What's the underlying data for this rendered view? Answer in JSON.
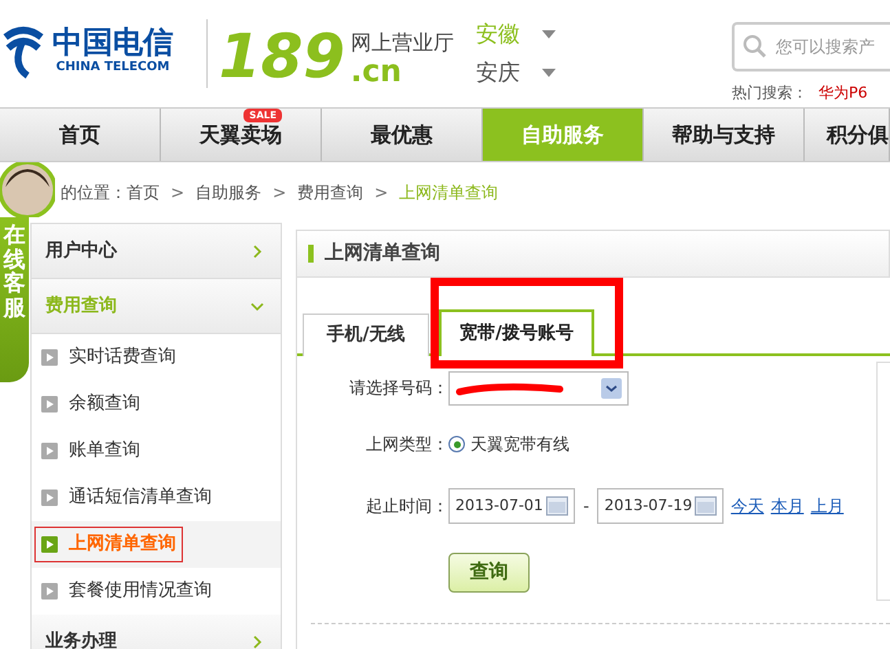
{
  "header": {
    "logo_cn": "中国电信",
    "logo_en": "CHINA TELECOM",
    "brand": "189",
    "brand_suffix": ".cn",
    "hall": "网上营业厅",
    "province": "安徽",
    "city": "安庆",
    "search": {
      "placeholder": "您可以搜索产"
    },
    "hot_label": "热门搜索：",
    "hot_terms": [
      "华为P6"
    ]
  },
  "nav": [
    {
      "label": "首页",
      "selected": false
    },
    {
      "label": "天翼卖场",
      "selected": false,
      "badge": "SALE"
    },
    {
      "label": "最优惠",
      "selected": false
    },
    {
      "label": "自助服务",
      "selected": true
    },
    {
      "label": "帮助与支持",
      "selected": false
    },
    {
      "label": "积分俱",
      "selected": false
    }
  ],
  "breadcrumb": [
    {
      "kind": "text",
      "text": "的位置："
    },
    {
      "kind": "link",
      "text": "首页"
    },
    {
      "kind": "sep",
      "text": ">"
    },
    {
      "kind": "link",
      "text": "自助服务"
    },
    {
      "kind": "sep",
      "text": ">"
    },
    {
      "kind": "link",
      "text": "费用查询"
    },
    {
      "kind": "sep",
      "text": ">"
    },
    {
      "kind": "current",
      "text": "上网清单查询"
    }
  ],
  "chat": {
    "label": "在线客服"
  },
  "sidebar": [
    {
      "label": "用户中心",
      "expanded": false
    },
    {
      "label": "费用查询",
      "expanded": true,
      "children": [
        {
          "label": "实时话费查询",
          "selected": false
        },
        {
          "label": "余额查询",
          "selected": false
        },
        {
          "label": "账单查询",
          "selected": false
        },
        {
          "label": "通话短信清单查询",
          "selected": false
        },
        {
          "label": "上网清单查询",
          "selected": true
        },
        {
          "label": "套餐使用情况查询",
          "selected": false
        }
      ]
    },
    {
      "label": "业务办理",
      "expanded": false
    }
  ],
  "panel": {
    "title": "上网清单查询",
    "tabs": [
      {
        "label": "手机/无线",
        "selected": false
      },
      {
        "label": "宽带/拨号账号",
        "selected": true
      }
    ],
    "number_label": "请选择号码：",
    "type_label": "上网类型：",
    "radio": {
      "label": "天翼宽带有线",
      "selected": true
    },
    "date_label": "起止时间：",
    "start_date": "2013-07-01",
    "date_sep": "-",
    "end_date": "2013-07-19",
    "quick_links": [
      "今天",
      "本月",
      "上月"
    ],
    "submit": "查询"
  }
}
